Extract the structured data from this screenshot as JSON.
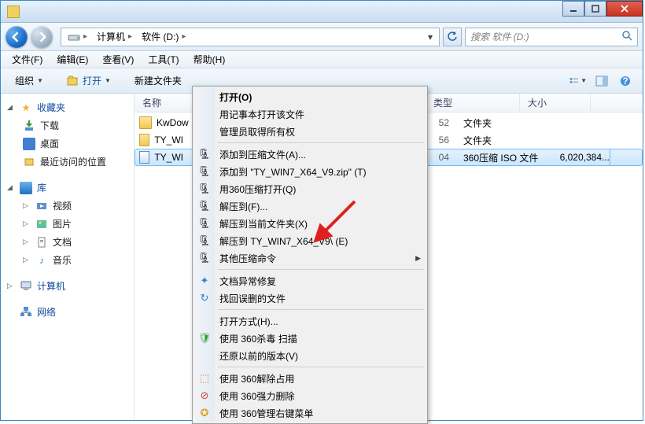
{
  "address": {
    "computer": "计算机",
    "drive": "软件 (D:)"
  },
  "search": {
    "placeholder": "搜索 软件 (D:)"
  },
  "menus": {
    "file": "文件(F)",
    "edit": "编辑(E)",
    "view": "查看(V)",
    "tools": "工具(T)",
    "help": "帮助(H)"
  },
  "toolbar": {
    "organize": "组织",
    "open": "打开",
    "newfolder": "新建文件夹"
  },
  "columns": {
    "name": "名称",
    "type": "类型",
    "size": "大小"
  },
  "sidebar": {
    "fav": {
      "head": "收藏夹",
      "downloads": "下载",
      "desktop": "桌面",
      "recent": "最近访问的位置"
    },
    "lib": {
      "head": "库",
      "video": "视频",
      "pictures": "图片",
      "docs": "文档",
      "music": "音乐"
    },
    "computer": "计算机",
    "network": "网络"
  },
  "files": [
    {
      "name": "KwDow",
      "date_tail": "",
      "type": "文件夹",
      "size": "",
      "icon": "folder"
    },
    {
      "name": "TY_WI",
      "date_tail": "52",
      "type": "文件夹",
      "size": "",
      "icon": "folder"
    },
    {
      "name": "TY_WI",
      "date_tail": "56",
      "type": "文件夹",
      "size": "",
      "icon": "folder",
      "hidden_date": true
    },
    {
      "name": "",
      "date_tail": "04",
      "type": "360压缩 ISO 文件",
      "size": "6,020,384...",
      "icon": "iso",
      "selected": true
    }
  ],
  "sel_file_display": "TY_WI",
  "ctx": {
    "open": "打开(O)",
    "notepad": "用记事本打开该文件",
    "admin": "管理员取得所有权",
    "addarc": "添加到压缩文件(A)...",
    "addzip": "添加到 \"TY_WIN7_X64_V9.zip\" (T)",
    "open360": "用360压缩打开(Q)",
    "extractto": "解压到(F)...",
    "extracthere": "解压到当前文件夹(X)",
    "extractnamed": "解压到 TY_WIN7_X64_V9\\ (E)",
    "otherarc": "其他压缩命令",
    "docrepair": "文档异常修复",
    "recover": "找回误删的文件",
    "openwith": "打开方式(H)...",
    "scan360": "使用 360杀毒 扫描",
    "prevver": "还原以前的版本(V)",
    "unlock360": "使用 360解除占用",
    "forcedel360": "使用 360强力删除",
    "ctxmenu360": "使用 360管理右键菜单"
  }
}
